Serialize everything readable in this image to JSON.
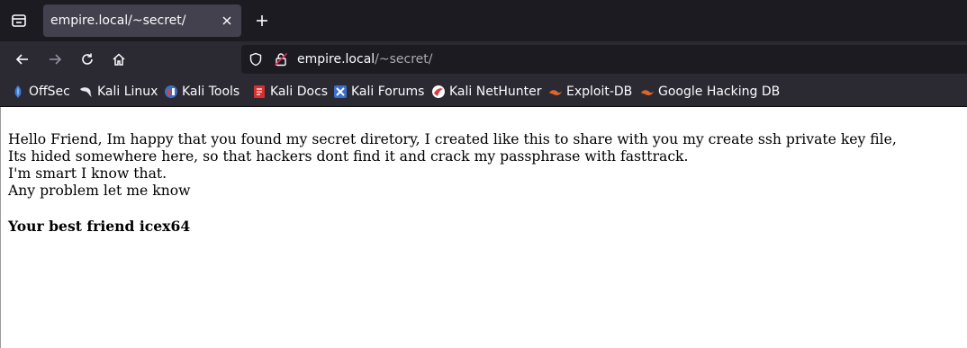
{
  "tab": {
    "title": "empire.local/~secret/"
  },
  "urlbar": {
    "host": "empire.local",
    "path": "/~secret/"
  },
  "bookmarks": [
    {
      "label": "OffSec",
      "icon": "offsec-icon"
    },
    {
      "label": "Kali Linux",
      "icon": "kali-dragon-icon"
    },
    {
      "label": "Kali Tools",
      "icon": "kali-tools-icon"
    },
    {
      "label": "Kali Docs",
      "icon": "kali-docs-icon"
    },
    {
      "label": "Kali Forums",
      "icon": "kali-forums-icon"
    },
    {
      "label": "Kali NetHunter",
      "icon": "kali-nethunter-icon"
    },
    {
      "label": "Exploit-DB",
      "icon": "exploit-db-icon"
    },
    {
      "label": "Google Hacking DB",
      "icon": "ghdb-icon"
    }
  ],
  "page": {
    "lines": [
      "Hello Friend, Im happy that you found my secret diretory, I created like this to share with you my create ssh private key file,",
      "Its hided somewhere here, so that hackers dont find it and crack my passphrase with fasttrack.",
      "I'm smart I know that.",
      "Any problem let me know"
    ],
    "signature": "Your best friend icex64"
  },
  "colors": {
    "tabstrip_bg": "#1c1b22",
    "toolbar_bg": "#2b2a33",
    "active_tab_bg": "#42414d",
    "text_light": "#fbfbfe",
    "url_path": "#a9a9b2"
  }
}
